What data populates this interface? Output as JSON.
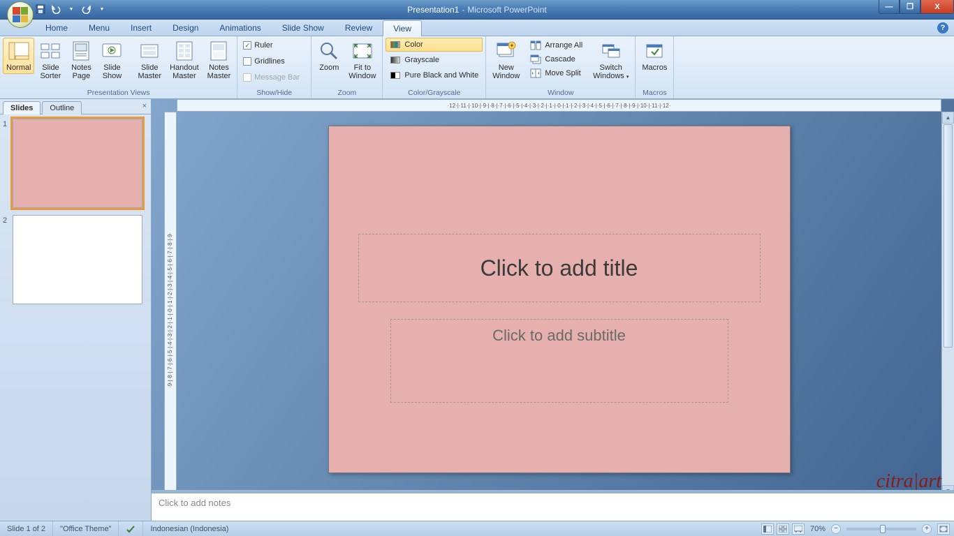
{
  "titlebar": {
    "doc": "Presentation1",
    "app": "Microsoft PowerPoint",
    "min": "—",
    "max": "❐",
    "close": "X"
  },
  "tabs": {
    "home": "Home",
    "menu": "Menu",
    "insert": "Insert",
    "design": "Design",
    "animations": "Animations",
    "slideshow": "Slide Show",
    "review": "Review",
    "view": "View"
  },
  "ribbon": {
    "views": {
      "normal": "Normal",
      "sorter": "Slide\nSorter",
      "notespage": "Notes\nPage",
      "slideshow": "Slide\nShow",
      "slidemaster": "Slide\nMaster",
      "handout": "Handout\nMaster",
      "notesmaster": "Notes\nMaster",
      "group": "Presentation Views"
    },
    "showhide": {
      "ruler": "Ruler",
      "gridlines": "Gridlines",
      "messagebar": "Message Bar",
      "group": "Show/Hide"
    },
    "zoom": {
      "zoom": "Zoom",
      "fit": "Fit to\nWindow",
      "group": "Zoom"
    },
    "color": {
      "color": "Color",
      "grayscale": "Grayscale",
      "pbw": "Pure Black and White",
      "group": "Color/Grayscale"
    },
    "window": {
      "newwindow": "New\nWindow",
      "arrange": "Arrange All",
      "cascade": "Cascade",
      "movesplit": "Move Split",
      "switch": "Switch\nWindows",
      "group": "Window"
    },
    "macros": {
      "macros": "Macros",
      "group": "Macros"
    }
  },
  "pane": {
    "slides": "Slides",
    "outline": "Outline",
    "thumb1": "1",
    "thumb2": "2"
  },
  "slide": {
    "title_ph": "Click to add title",
    "subtitle_ph": "Click to add subtitle"
  },
  "notes": {
    "placeholder": "Click to add notes"
  },
  "status": {
    "slide": "Slide 1 of 2",
    "theme": "\"Office Theme\"",
    "lang": "Indonesian (Indonesia)",
    "zoom": "70%"
  },
  "ruler_h": "·12·|·11·|·10·|·9·|·8·|·7·|·6·|·5·|·4·|·3·|·2·|·1·|·0·|·1·|·2·|·3·|·4·|·5·|·6·|·7·|·8·|·9·|·10·|·11·|·12·",
  "ruler_v": "·9·|·8·|·7·|·6·|·5·|·4·|·3·|·2·|·1·|·0·|·1·|·2·|·3·|·4·|·5·|·6·|·7·|·8·|·9·",
  "watermark": "citra|art"
}
